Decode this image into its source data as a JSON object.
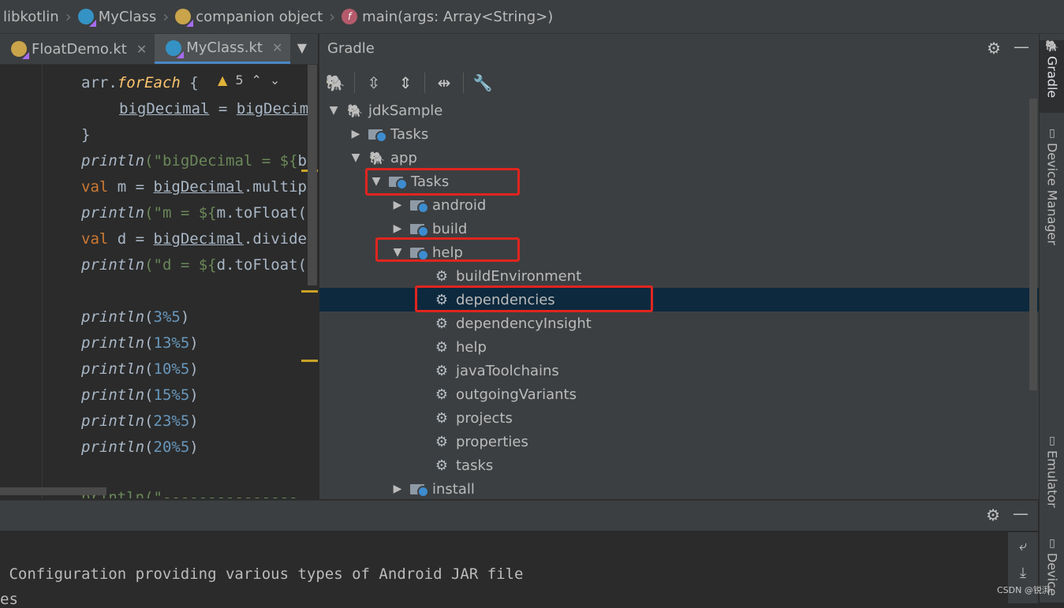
{
  "breadcrumb": {
    "items": [
      "libkotlin",
      "MyClass",
      "companion object",
      "main(args: Array<String>)"
    ]
  },
  "editor_tabs": [
    {
      "label": "FloatDemo.kt",
      "active": false
    },
    {
      "label": "MyClass.kt",
      "active": true
    }
  ],
  "editor": {
    "warning_count": "5",
    "lines": {
      "l1_a": "arr.",
      "l1_b": "forEach",
      "l1_c": " {",
      "l2_a": "bigDecimal",
      "l2_b": " = ",
      "l2_c": "bigDecim",
      "l3": "}",
      "l4_a": "println",
      "l4_b": "(\"bigDecimal = ${",
      "l4_c": "b",
      "l5_a": "val",
      "l5_b": " m = ",
      "l5_c": "bigDecimal",
      "l5_d": ".multip",
      "l6_a": "println",
      "l6_b": "(\"m = ${",
      "l6_c": "m.toFloat(",
      "l7_a": "val",
      "l7_b": " d = ",
      "l7_c": "bigDecimal",
      "l7_d": ".divide",
      "l8_a": "println",
      "l8_b": "(\"d = ${",
      "l8_c": "d.toFloat(",
      "l9_a": "println",
      "l9_b": "(",
      "l9_c": "3%5",
      "l9_d": ")",
      "l10_a": "println",
      "l10_b": "(",
      "l10_c": "13%5",
      "l10_d": ")",
      "l11_a": "println",
      "l11_b": "(",
      "l11_c": "10%5",
      "l11_d": ")",
      "l12_a": "println",
      "l12_b": "(",
      "l12_c": "15%5",
      "l12_d": ")",
      "l13_a": "println",
      "l13_b": "(",
      "l13_c": "23%5",
      "l13_d": ")",
      "l14_a": "println",
      "l14_b": "(",
      "l14_c": "20%5",
      "l14_d": ")",
      "l15": "println(\"---------------"
    }
  },
  "gradle": {
    "title": "Gradle",
    "tree": [
      {
        "label": "jdkSample",
        "type": "project",
        "expanded": true
      },
      {
        "label": "Tasks",
        "type": "folder",
        "expanded": false
      },
      {
        "label": "app",
        "type": "module",
        "expanded": true
      },
      {
        "label": "Tasks",
        "type": "folder",
        "expanded": true
      },
      {
        "label": "android",
        "type": "folder",
        "expanded": false
      },
      {
        "label": "build",
        "type": "folder",
        "expanded": false
      },
      {
        "label": "help",
        "type": "folder",
        "expanded": true
      },
      {
        "label": "buildEnvironment",
        "type": "task"
      },
      {
        "label": "dependencies",
        "type": "task",
        "selected": true
      },
      {
        "label": "dependencyInsight",
        "type": "task"
      },
      {
        "label": "help",
        "type": "task"
      },
      {
        "label": "javaToolchains",
        "type": "task"
      },
      {
        "label": "outgoingVariants",
        "type": "task"
      },
      {
        "label": "projects",
        "type": "task"
      },
      {
        "label": "properties",
        "type": "task"
      },
      {
        "label": "tasks",
        "type": "task"
      },
      {
        "label": "install",
        "type": "folder",
        "expanded": false
      }
    ]
  },
  "right_strip": {
    "gradle": "Gradle",
    "device_manager": "Device Manager",
    "emulator": "Emulator",
    "device": "Device"
  },
  "console": {
    "line1": " Configuration providing various types of Android JAR file",
    "line2": "es"
  },
  "watermark": "CSDN @锐湃",
  "colors": {
    "highlight_box": "#e0251f",
    "selection": "#0d293e",
    "accent_tab": "#4a88c7"
  }
}
